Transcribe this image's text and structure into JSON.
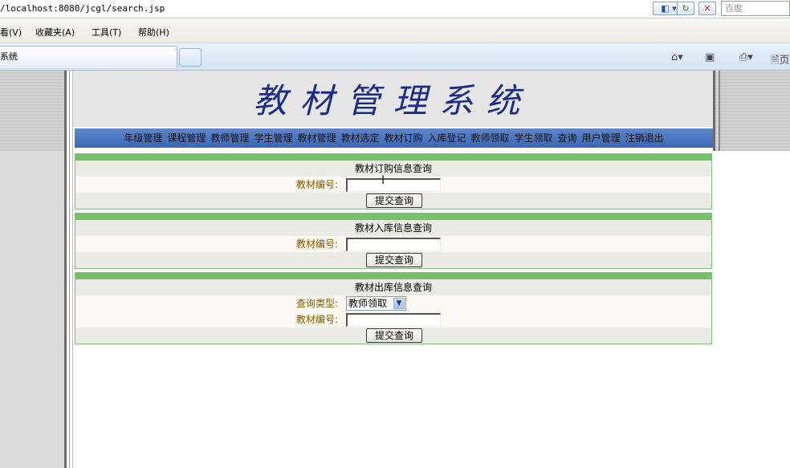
{
  "browser": {
    "url": "/localhost:8080/jcgl/search.jsp",
    "search_placeholder": "百度",
    "menu": [
      "看(V)",
      "收藏夹(A)",
      "工具(T)",
      "帮助(H)"
    ],
    "tab_title": "系统",
    "command_icons": [
      "home-icon",
      "feed-icon",
      "print-icon",
      "page-icon"
    ],
    "page_partial": "页"
  },
  "site": {
    "title": "教材管理系统",
    "nav": [
      "年级管理",
      "课程管理",
      "教师管理",
      "学生管理",
      "教材管理",
      "教材选定",
      "教材订购",
      "入库登记",
      "教师领取",
      "学生领取",
      "查询",
      "用户管理",
      "注销退出"
    ]
  },
  "panels": {
    "order": {
      "heading": "教材订购信息查询",
      "label_code": "教材编号:",
      "code_value": "",
      "submit": "提交查询"
    },
    "stock_in": {
      "heading": "教材入库信息查询",
      "label_code": "教材编号:",
      "code_value": "",
      "submit": "提交查询"
    },
    "stock_out": {
      "heading": "教材出库信息查询",
      "label_type": "查询类型:",
      "type_selected": "教师领取",
      "label_code": "教材编号:",
      "code_value": "",
      "submit": "提交查询"
    }
  },
  "colors": {
    "title": "#1a2b8a",
    "nav_bg": "#4a74c0",
    "panel_bar": "#76c06b",
    "label": "#8a5a00"
  }
}
